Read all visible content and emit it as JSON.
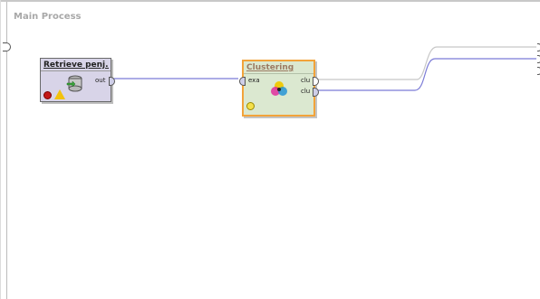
{
  "process": {
    "title": "Main Process"
  },
  "operators": {
    "retrieve": {
      "title": "Retrieve penj...",
      "out_port": "out"
    },
    "clustering": {
      "title": "Clustering",
      "in_port": "exa",
      "out_port_1": "clu",
      "out_port_2": "clu"
    }
  },
  "icons": {
    "retrieve": "database-icon",
    "clustering": "clustering-icon",
    "error": "error-indicator-icon",
    "warning": "warning-icon",
    "status": "status-indicator-icon"
  },
  "colors": {
    "selected_border": "#f2a33a",
    "wire": "#7b7bd6",
    "operator_bg": "#d8d4e8",
    "cluster_bg": "#dbe8d0"
  }
}
